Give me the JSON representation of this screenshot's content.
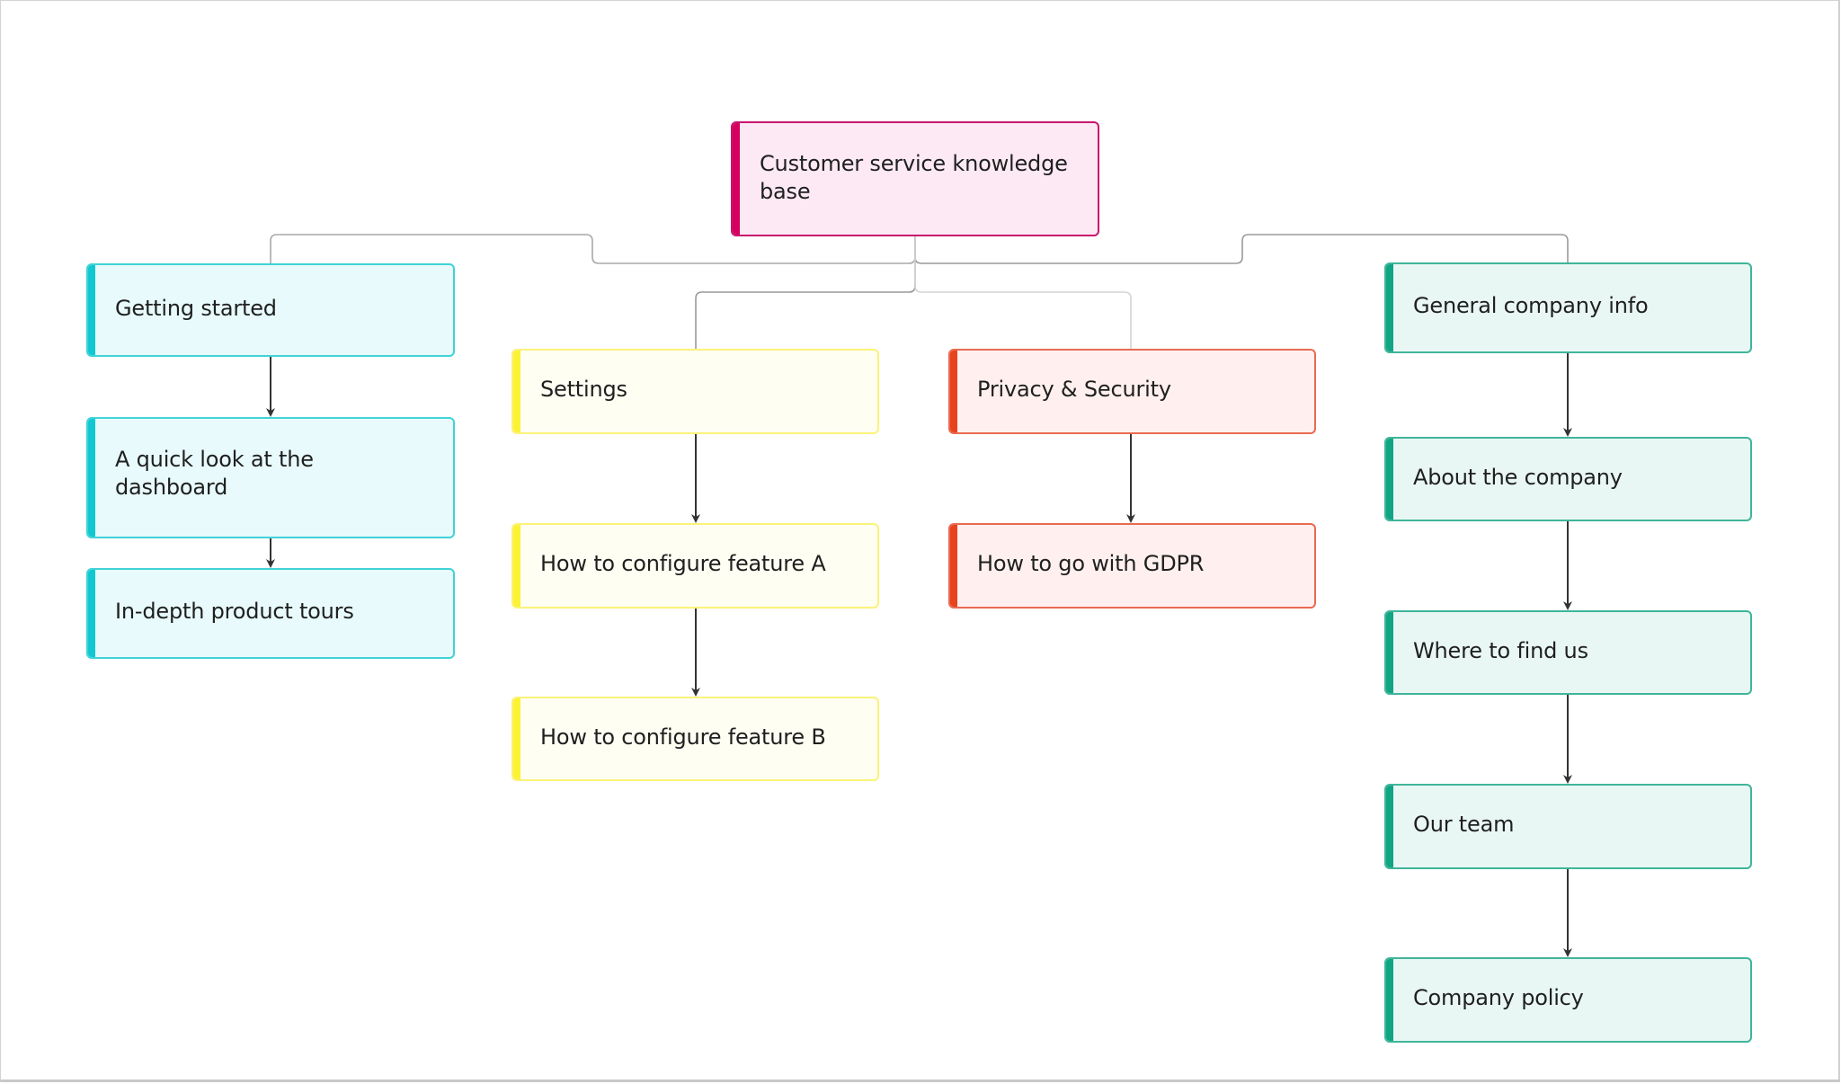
{
  "diagram": {
    "type": "tree",
    "root": {
      "id": "root",
      "label": "Customer service knowledge base",
      "color": "#d6005f"
    },
    "colors": {
      "pink": "#d6005f",
      "cyan": "#12c8d0",
      "yellow": "#fbf235",
      "red": "#e8431f",
      "green": "#12a584",
      "connector": "#9a9a9a",
      "arrow": "#333333"
    },
    "branches": [
      {
        "id": "getting-started",
        "label": "Getting started",
        "color": "cyan",
        "children": [
          {
            "id": "quick-look",
            "label": "A quick look at the dashboard"
          },
          {
            "id": "product-tours",
            "label": "In-depth product tours"
          }
        ]
      },
      {
        "id": "settings",
        "label": "Settings",
        "color": "yellow",
        "children": [
          {
            "id": "feature-a",
            "label": "How to configure feature A"
          },
          {
            "id": "feature-b",
            "label": "How to configure feature B"
          }
        ]
      },
      {
        "id": "privacy-security",
        "label": "Privacy & Security",
        "color": "red",
        "children": [
          {
            "id": "gdpr",
            "label": "How to go with GDPR"
          }
        ]
      },
      {
        "id": "company-info",
        "label": "General company info",
        "color": "green",
        "children": [
          {
            "id": "about",
            "label": "About the company"
          },
          {
            "id": "find-us",
            "label": "Where to find us"
          },
          {
            "id": "team",
            "label": "Our team"
          },
          {
            "id": "policy",
            "label": "Company policy"
          }
        ]
      }
    ]
  }
}
